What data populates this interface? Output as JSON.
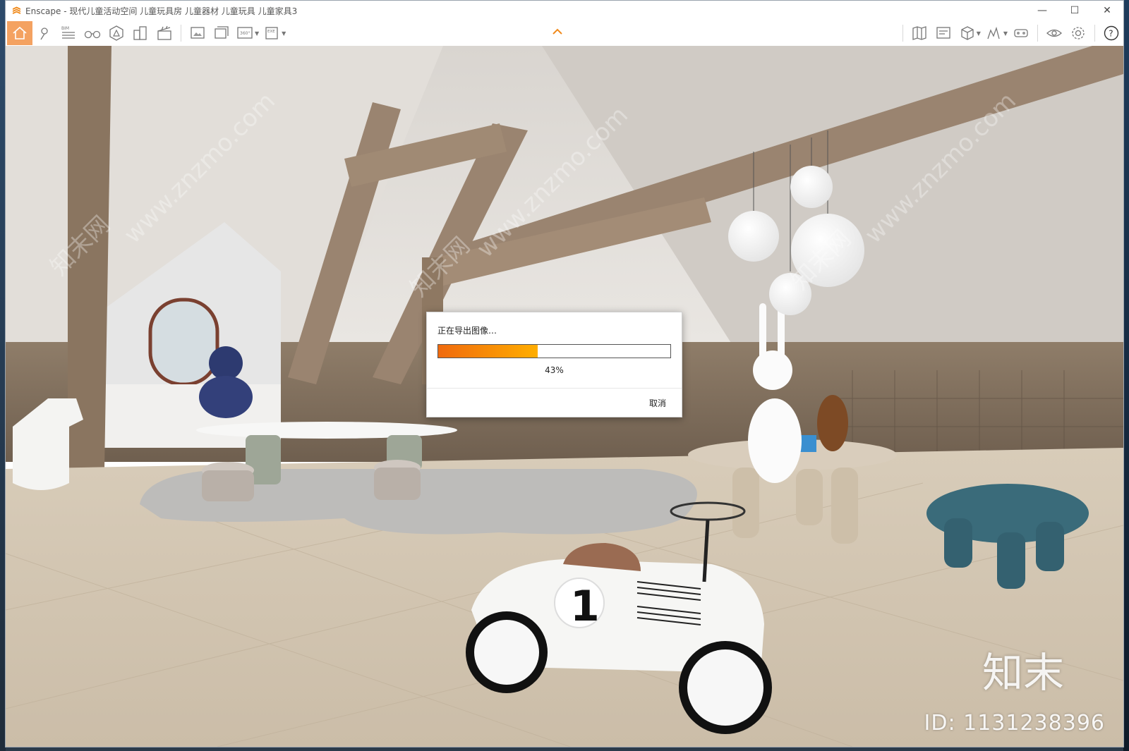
{
  "window": {
    "title": "Enscape - 现代儿童活动空间 儿童玩具房 儿童器材 儿童玩具 儿童家具3",
    "minimize_glyph": "—",
    "maximize_glyph": "☐",
    "close_glyph": "✕"
  },
  "toolbar": {
    "left_tools": [
      "home-icon",
      "location-pin-icon",
      "bim-icon",
      "binoculars-icon",
      "asset-library-icon",
      "buildings-icon",
      "clapperboard-icon",
      "screenshot-icon",
      "batch-render-icon",
      "panorama-360-icon",
      "exe-export-icon"
    ],
    "bim_label": "BIM",
    "pano_label": "360°",
    "exe_label": "EXE",
    "right_tools": [
      "map-icon",
      "views-icon",
      "cube-icon",
      "chart-icon",
      "vr-headset-icon",
      "eye-icon",
      "gear-icon",
      "help-icon"
    ],
    "help_glyph": "?",
    "collapse_glyph": "⌃",
    "accent": "#f4a261"
  },
  "export_dialog": {
    "title": "正在导出图像…",
    "progress": 0.43,
    "progress_text": "43%",
    "cancel_label": "取消",
    "fill_start": "#f06a0e",
    "fill_end": "#ffae00"
  },
  "watermark": {
    "logo": "知末",
    "id_text": "ID: 1131238396",
    "site": "www.znzmo.com",
    "brand": "知末网"
  },
  "scene": {
    "race_car_number": "1"
  }
}
